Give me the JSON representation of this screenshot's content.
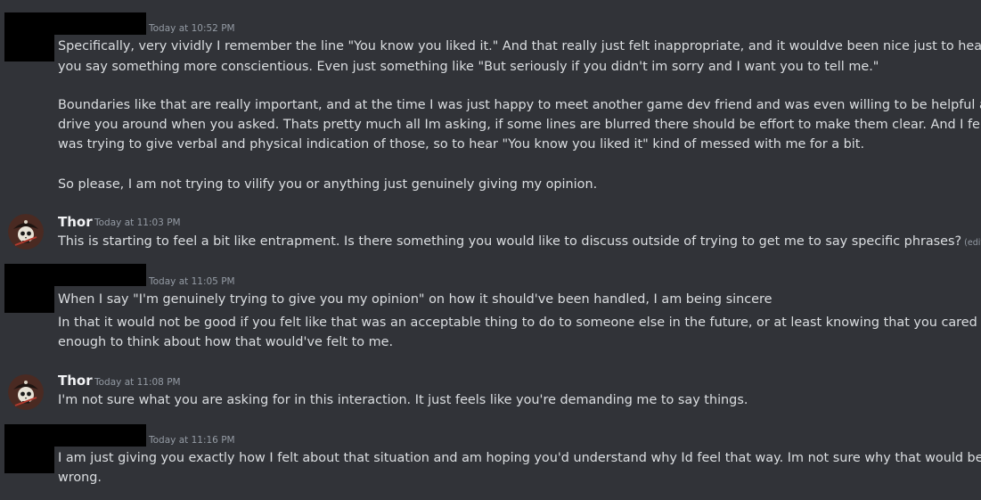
{
  "messages": [
    {
      "timestamp": "Today at 10:52 PM",
      "lines": [
        "Specifically, very vividly I remember the line \"You know you liked it.\" And that really just felt inappropriate, and it wouldve been nice just to hear",
        "you say something more conscientious. Even just something like \"But seriously if you didn't im sorry and I want you to tell me.\"",
        "Boundaries like that are really important, and at the time I was just happy to meet another game dev friend and was even willing to be helpful and",
        "drive you around when you asked. Thats pretty much all Im asking, if some lines are blurred there should be effort to make them clear. And I felt I",
        "was trying to give verbal and physical indication of those, so to hear \"You know you liked it\" kind of messed with me for a bit.",
        "So please, I am not trying to vilify you or anything just genuinely giving my opinion."
      ]
    },
    {
      "author": "Thor",
      "timestamp": "Today at 11:03 PM",
      "text": "This is starting to feel a bit like entrapment. Is there something you would like to discuss outside of trying to get me to say specific phrases?",
      "edited": "(edited)"
    },
    {
      "timestamp": "Today at 11:05 PM",
      "lines": [
        "When I say \"I'm genuinely trying to give you my opinion\" on how it should've been handled, I am being sincere",
        "In that it would not be good if you felt like that was an acceptable thing to do to someone else in the future, or at least knowing that you cared",
        "enough to think about how that would've felt to me."
      ]
    },
    {
      "author": "Thor",
      "timestamp": "Today at 11:08 PM",
      "text": "I'm not sure what you are asking for in this interaction. It just feels like you're demanding me to say things."
    },
    {
      "timestamp": "Today at 11:16 PM",
      "lines": [
        "I am just giving you exactly how I felt about that situation and am hoping you'd understand why Id feel that way. Im not sure why that would be",
        "wrong."
      ]
    }
  ]
}
